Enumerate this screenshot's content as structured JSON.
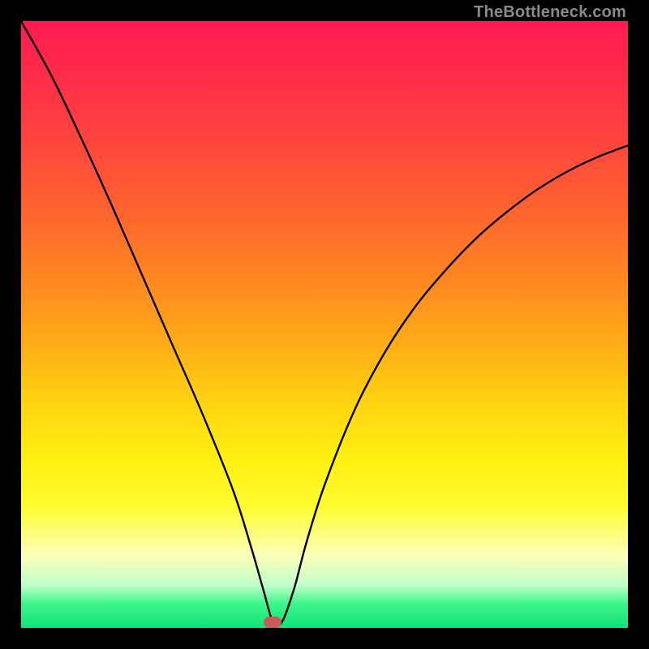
{
  "watermark": "TheBottleneck.com",
  "marker": {
    "x_frac": 0.415,
    "y_frac": 0.99
  },
  "chart_data": {
    "type": "line",
    "title": "",
    "xlabel": "",
    "ylabel": "",
    "xlim": [
      0,
      1
    ],
    "ylim": [
      0,
      1
    ],
    "series": [
      {
        "name": "curve",
        "x": [
          0.0,
          0.05,
          0.1,
          0.15,
          0.2,
          0.25,
          0.3,
          0.35,
          0.38,
          0.4,
          0.415,
          0.43,
          0.45,
          0.47,
          0.5,
          0.55,
          0.6,
          0.65,
          0.7,
          0.75,
          0.8,
          0.85,
          0.9,
          0.95,
          1.0
        ],
        "values": [
          1.0,
          0.91,
          0.805,
          0.695,
          0.58,
          0.465,
          0.35,
          0.225,
          0.13,
          0.06,
          0.01,
          0.01,
          0.065,
          0.14,
          0.235,
          0.36,
          0.455,
          0.53,
          0.59,
          0.642,
          0.685,
          0.722,
          0.752,
          0.776,
          0.795
        ]
      }
    ],
    "annotations": [
      {
        "type": "marker",
        "x": 0.415,
        "y": 0.01,
        "color": "#cc5a5a",
        "shape": "rounded-rect"
      }
    ],
    "background_gradient": {
      "direction": "vertical",
      "stops": [
        {
          "pos": 0.0,
          "color": "#ff1a52"
        },
        {
          "pos": 0.5,
          "color": "#ff8522"
        },
        {
          "pos": 0.75,
          "color": "#fff010"
        },
        {
          "pos": 0.95,
          "color": "#3df58a"
        },
        {
          "pos": 1.0,
          "color": "#11e27a"
        }
      ]
    }
  }
}
